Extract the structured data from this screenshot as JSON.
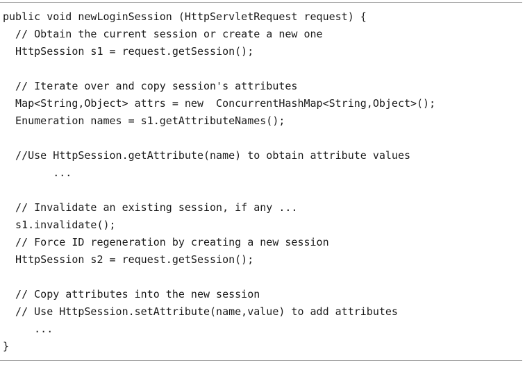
{
  "code": {
    "lines": [
      "public void newLoginSession (HttpServletRequest request) {",
      "  // Obtain the current session or create a new one",
      "  HttpSession s1 = request.getSession();",
      "",
      "  // Iterate over and copy session's attributes",
      "  Map<String,Object> attrs = new  ConcurrentHashMap<String,Object>();",
      "  Enumeration names = s1.getAttributeNames();",
      "",
      "  //Use HttpSession.getAttribute(name) to obtain attribute values",
      "        ...",
      "",
      "  // Invalidate an existing session, if any ...",
      "  s1.invalidate();",
      "  // Force ID regeneration by creating a new session",
      "  HttpSession s2 = request.getSession();",
      "",
      "  // Copy attributes into the new session",
      "  // Use HttpSession.setAttribute(name,value) to add attributes",
      "     ...",
      "}"
    ]
  }
}
